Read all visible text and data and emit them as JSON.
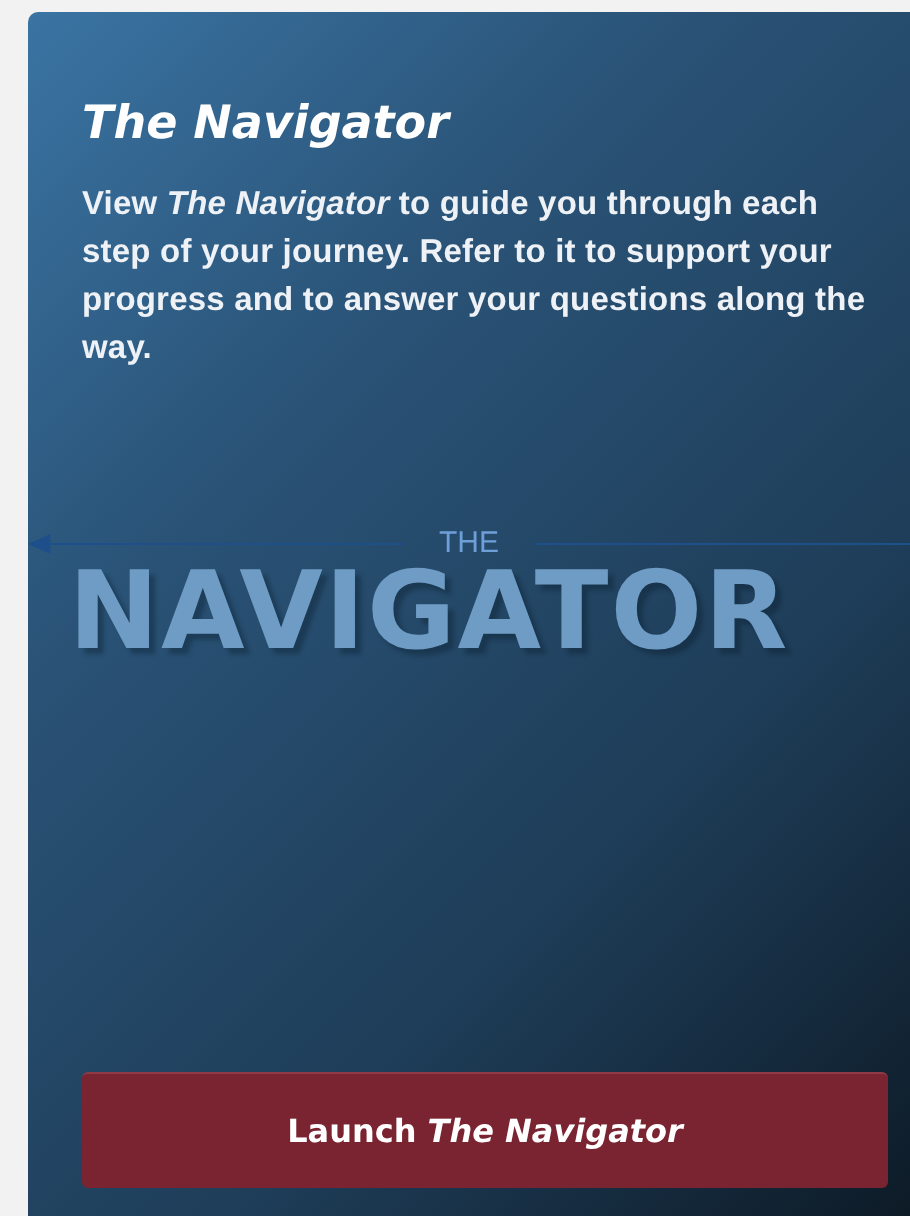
{
  "card": {
    "title": "The Navigator",
    "description": "View *The Navigator* to guide you through each step of your journey. Refer to it to support your progress and to answer your questions along the way.",
    "logo": {
      "small_text": "THE",
      "large_text": "NAVIGATOR"
    },
    "button": "Launch *The Navigator*"
  }
}
